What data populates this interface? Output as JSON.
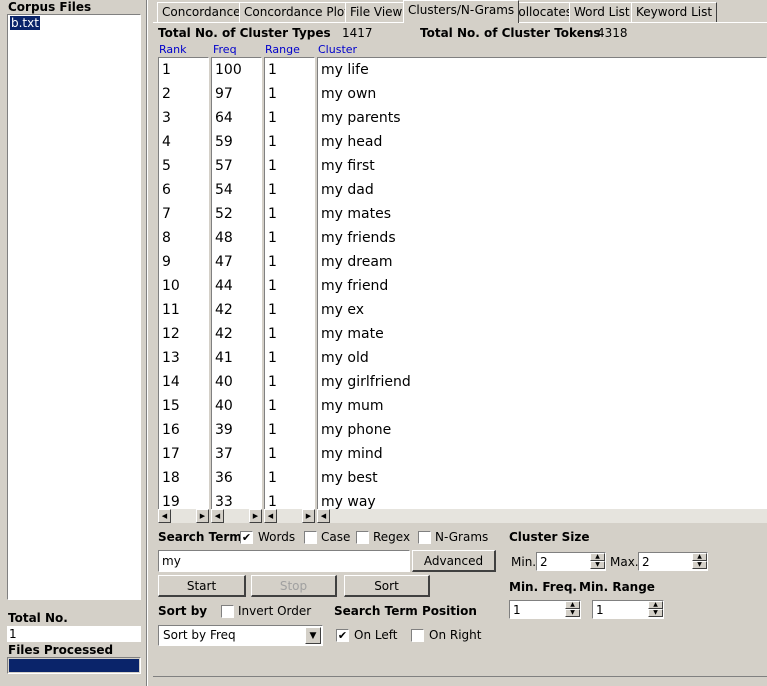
{
  "sidebar": {
    "corpus_files_label": "Corpus Files",
    "files": [
      "b.txt"
    ],
    "total_no_label": "Total No.",
    "total_no_value": "1",
    "files_processed_label": "Files Processed"
  },
  "tabs": [
    "Concordance",
    "Concordance Plot",
    "File View",
    "Clusters/N-Grams",
    "Collocates",
    "Word List",
    "Keyword List"
  ],
  "active_tab": "Clusters/N-Grams",
  "stats": {
    "types_label": "Total No. of Cluster Types",
    "types_value": "1417",
    "tokens_label": "Total No. of Cluster Tokens",
    "tokens_value": "4318"
  },
  "columns": [
    "Rank",
    "Freq",
    "Range",
    "Cluster"
  ],
  "rows": [
    {
      "rank": "1",
      "freq": "100",
      "range": "1",
      "cluster": "my life"
    },
    {
      "rank": "2",
      "freq": "97",
      "range": "1",
      "cluster": "my own"
    },
    {
      "rank": "3",
      "freq": "64",
      "range": "1",
      "cluster": "my parents"
    },
    {
      "rank": "4",
      "freq": "59",
      "range": "1",
      "cluster": "my head"
    },
    {
      "rank": "5",
      "freq": "57",
      "range": "1",
      "cluster": "my first"
    },
    {
      "rank": "6",
      "freq": "54",
      "range": "1",
      "cluster": "my dad"
    },
    {
      "rank": "7",
      "freq": "52",
      "range": "1",
      "cluster": "my mates"
    },
    {
      "rank": "8",
      "freq": "48",
      "range": "1",
      "cluster": "my friends"
    },
    {
      "rank": "9",
      "freq": "47",
      "range": "1",
      "cluster": "my dream"
    },
    {
      "rank": "10",
      "freq": "44",
      "range": "1",
      "cluster": "my friend"
    },
    {
      "rank": "11",
      "freq": "42",
      "range": "1",
      "cluster": "my ex"
    },
    {
      "rank": "12",
      "freq": "42",
      "range": "1",
      "cluster": "my mate"
    },
    {
      "rank": "13",
      "freq": "41",
      "range": "1",
      "cluster": "my old"
    },
    {
      "rank": "14",
      "freq": "40",
      "range": "1",
      "cluster": "my girlfriend"
    },
    {
      "rank": "15",
      "freq": "40",
      "range": "1",
      "cluster": "my mum"
    },
    {
      "rank": "16",
      "freq": "39",
      "range": "1",
      "cluster": "my phone"
    },
    {
      "rank": "17",
      "freq": "37",
      "range": "1",
      "cluster": "my mind"
    },
    {
      "rank": "18",
      "freq": "36",
      "range": "1",
      "cluster": "my best"
    },
    {
      "rank": "19",
      "freq": "33",
      "range": "1",
      "cluster": "my way"
    }
  ],
  "search": {
    "label": "Search Term",
    "words_label": "Words",
    "words_checked": true,
    "case_label": "Case",
    "case_checked": false,
    "regex_label": "Regex",
    "regex_checked": false,
    "ngrams_label": "N-Grams",
    "ngrams_checked": false,
    "value": "my",
    "advanced_label": "Advanced"
  },
  "buttons": {
    "start": "Start",
    "stop": "Stop",
    "sort": "Sort"
  },
  "cluster_size": {
    "label": "Cluster Size",
    "min_label": "Min.",
    "min_value": "2",
    "max_label": "Max.",
    "max_value": "2"
  },
  "min_freq": {
    "label": "Min. Freq.",
    "value": "1"
  },
  "min_range": {
    "label": "Min. Range",
    "value": "1"
  },
  "sort_by": {
    "label": "Sort by",
    "invert_label": "Invert Order",
    "invert_checked": false,
    "selected": "Sort by Freq"
  },
  "position": {
    "label": "Search Term Position",
    "on_left_label": "On Left",
    "on_left_checked": true,
    "on_right_label": "On Right",
    "on_right_checked": false
  },
  "colors": {
    "selection": "#0a246a",
    "progress": "#0a246a",
    "header_text": "#0000cc"
  }
}
